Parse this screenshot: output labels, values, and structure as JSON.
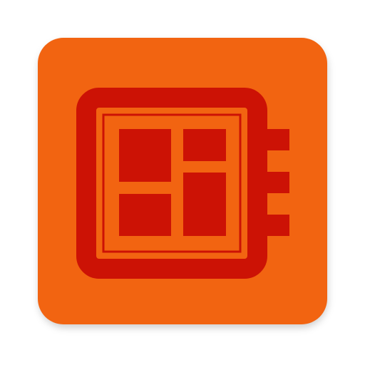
{
  "app_icon": {
    "icon": "board-notebook-icon",
    "colors": {
      "tile_background": "#F26411",
      "glyph": "#CC1205",
      "page_background": "#FFFFFF"
    }
  }
}
